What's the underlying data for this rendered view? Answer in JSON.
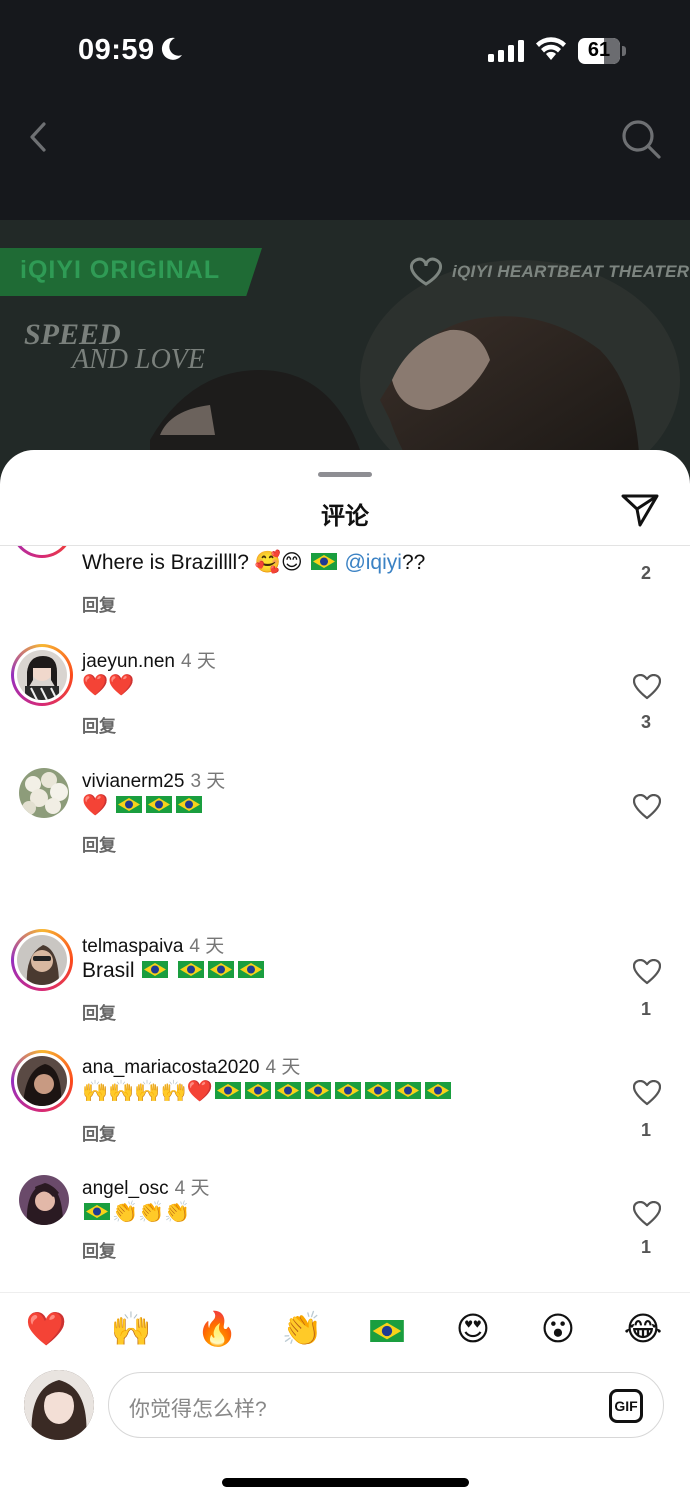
{
  "status_bar": {
    "time": "09:59",
    "battery": "61"
  },
  "banner": {
    "original_label": "iQIYI ORIGINAL",
    "theater_label": "iQIYI HEARTBEAT THEATER",
    "title_line1": "SPEED",
    "title_line2": "AND LOVE"
  },
  "sheet": {
    "title": "评论"
  },
  "comments": [
    {
      "username": "",
      "time": "",
      "text": "Where is Brazillll? 🥰😊",
      "mention": "@iqiyi",
      "suffix": "??",
      "reply": "回复",
      "likes": "2"
    },
    {
      "username": "jaeyun.nen",
      "time": "4 天",
      "text": "❤️❤️",
      "reply": "回复",
      "likes": "3"
    },
    {
      "username": "vivianerm25",
      "time": "3 天",
      "text": "❤️",
      "reply": "回复",
      "likes": ""
    },
    {
      "username": "telmaspaiva",
      "time": "4 天",
      "text": "Brasil",
      "reply": "回复",
      "likes": "1"
    },
    {
      "username": "ana_mariacosta2020",
      "time": "4 天",
      "text": "🙌🙌🙌🙌❤️",
      "reply": "回复",
      "likes": "1"
    },
    {
      "username": "angel_osc",
      "time": "4 天",
      "text": "👏👏👏",
      "reply": "回复",
      "likes": "1"
    }
  ],
  "emoji_bar": [
    "❤️",
    "🙌",
    "🔥",
    "👏",
    "🇧🇷",
    "😍",
    "😮",
    "😂"
  ],
  "composer": {
    "placeholder": "你觉得怎么样?",
    "gif_label": "GIF"
  }
}
